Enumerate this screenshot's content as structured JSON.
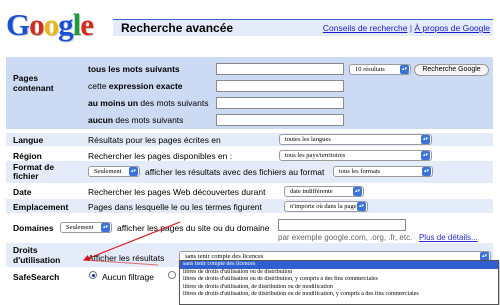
{
  "logo": {
    "text": "Google"
  },
  "header": {
    "title": "Recherche avancée",
    "link_tips": "Conseils de recherche",
    "separator": " | ",
    "link_about": "À propos de Google"
  },
  "pages_contenant": {
    "label": "Pages contenant",
    "rows": [
      {
        "bold": "tous les mots suivants",
        "rest": ""
      },
      {
        "prefix": "cette ",
        "bold": "expression exacte",
        "rest": ""
      },
      {
        "bold": "au moins un",
        "rest": " des mots suivants"
      },
      {
        "bold": "aucun",
        "rest": " des mots suivants"
      }
    ],
    "results_select": "10 résultats",
    "search_button": "Recherche Google"
  },
  "langue": {
    "label": "Langue",
    "text": "Résultats pour les pages écrites en",
    "select": "toutes les langues"
  },
  "region": {
    "label": "Région",
    "text": "Rechercher les pages disponibles en :",
    "select": "tous les pays/territoires"
  },
  "format": {
    "label": "Format de fichier",
    "select_mode": "Seulement",
    "text": "afficher les résultats avec des fichiers au format",
    "select_format": "tous les formats"
  },
  "date": {
    "label": "Date",
    "text": "Rechercher les pages Web découvertes durant",
    "select": "date indifférente"
  },
  "emplacement": {
    "label": "Emplacement",
    "text": "Pages dans lesquelle le ou les termes figurent",
    "select": "n'importe où dans la page"
  },
  "domaines": {
    "label": "Domaines",
    "select_mode": "Seulement",
    "text": "afficher les pages du site ou du domaine",
    "hint": "par exemple google.com, .org, .fr, etc.",
    "hint_link": "Plus de détails..."
  },
  "droits": {
    "label": "Droits d'utilisation",
    "text": "Afficher les résultats",
    "select": "sans tenir compte des licences",
    "options": [
      "sans tenir compte des licences",
      "libres de droits d'utilisation ou de distribution",
      "libres de droits d'utilisation ou de distribution, y compris à des fins commerciales",
      "libres de droits d'utilisation, de distribution ou de modification",
      "libres de droits d'utilisation, de distribution ou de modification, y compris à des fins commerciales"
    ]
  },
  "safesearch": {
    "label": "SafeSearch",
    "option_off": "Aucun filtrage"
  },
  "colors": {
    "accent_blue": "#3366cc",
    "header_bg": "#e5ecf9",
    "section_bg": "#cddaf3",
    "annotation_red": "#e01010"
  }
}
